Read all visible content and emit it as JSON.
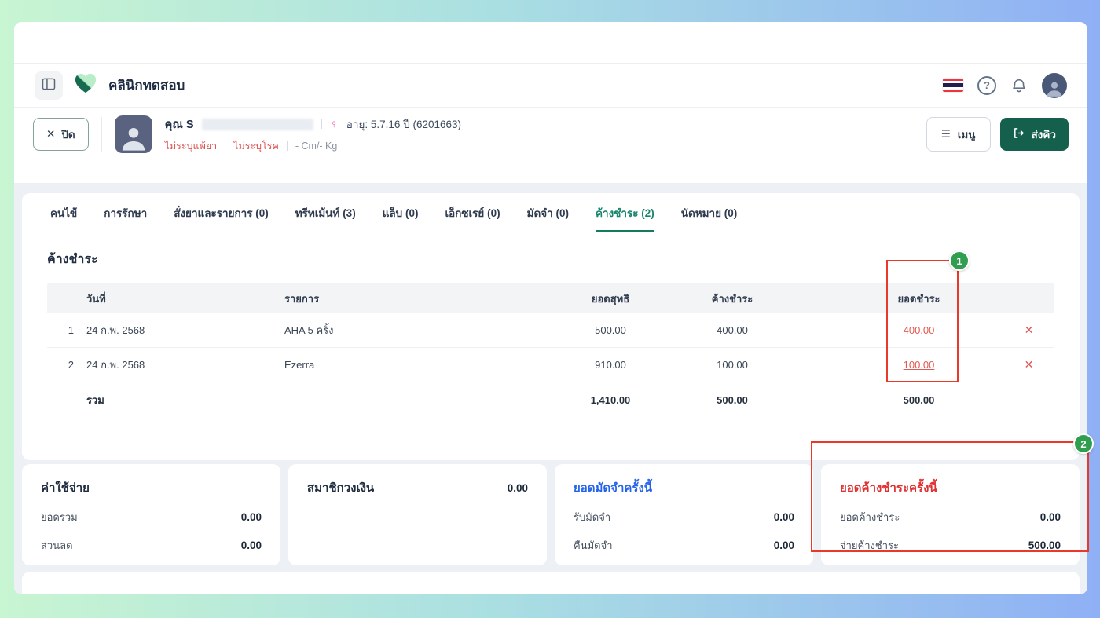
{
  "app": {
    "clinic_name": "คลินิกทดสอบ"
  },
  "icons": {
    "help": "?",
    "close": "✕",
    "delete": "✕",
    "menu": "☰",
    "female": "♀"
  },
  "patient": {
    "close_label": "ปิด",
    "name_prefix": "คุณ S",
    "age_text": "อายุ: 5.7.16 ปี (6201663)",
    "allergy_text": "ไม่ระบุแพ้ยา",
    "disease_text": "ไม่ระบุโรค",
    "body_text": "- Cm/- Kg",
    "menu_button": "เมนู",
    "send_queue_button": "ส่งคิว"
  },
  "tabs": [
    {
      "label": "คนไข้"
    },
    {
      "label": "การรักษา"
    },
    {
      "label": "สั่งยาและรายการ (0)"
    },
    {
      "label": "ทรีทเม้นท์ (3)"
    },
    {
      "label": "แล็บ (0)"
    },
    {
      "label": "เอ็กซเรย์ (0)"
    },
    {
      "label": "มัดจำ (0)"
    },
    {
      "label": "ค้างชำระ (2)"
    },
    {
      "label": "นัดหมาย (0)"
    }
  ],
  "overdue": {
    "section_title": "ค้างชำระ",
    "columns": {
      "date": "วันที่",
      "item": "รายการ",
      "net": "ยอดสุทธิ",
      "due": "ค้างชำระ",
      "paid": "ยอดชำระ"
    },
    "rows": [
      {
        "no": "1",
        "date": "24 ก.พ. 2568",
        "item": "AHA 5 ครั้ง",
        "net": "500.00",
        "due": "400.00",
        "paid": "400.00"
      },
      {
        "no": "2",
        "date": "24 ก.พ. 2568",
        "item": "Ezerra",
        "net": "910.00",
        "due": "100.00",
        "paid": "100.00"
      }
    ],
    "total": {
      "label": "รวม",
      "net": "1,410.00",
      "due": "500.00",
      "paid": "500.00"
    }
  },
  "summary": {
    "expense": {
      "title": "ค่าใช้จ่าย",
      "row1_label": "ยอดรวม",
      "row1_value": "0.00",
      "row2_label": "ส่วนลด",
      "row2_value": "0.00"
    },
    "member": {
      "title": "สมาชิกวงเงิน",
      "value": "0.00"
    },
    "deposit": {
      "title": "ยอดมัดจำครั้งนี้",
      "row1_label": "รับมัดจำ",
      "row1_value": "0.00",
      "row2_label": "คืนมัดจำ",
      "row2_value": "0.00"
    },
    "overdue_card": {
      "title": "ยอดค้างชำระครั้งนี้",
      "row1_label": "ยอดค้างชำระ",
      "row1_value": "0.00",
      "row2_label": "จ่ายค้างชำระ",
      "row2_value": "500.00"
    }
  },
  "annotations": {
    "badge_1": "1",
    "badge_2": "2"
  },
  "colors": {
    "brand_green_dark": "#15604c",
    "tab_active_green": "#17836a",
    "annotation_red": "#ea382b",
    "link_red": "#e25a52",
    "title_blue": "#2563eb",
    "title_red": "#e03131",
    "badge_green": "#2f9e4e"
  }
}
